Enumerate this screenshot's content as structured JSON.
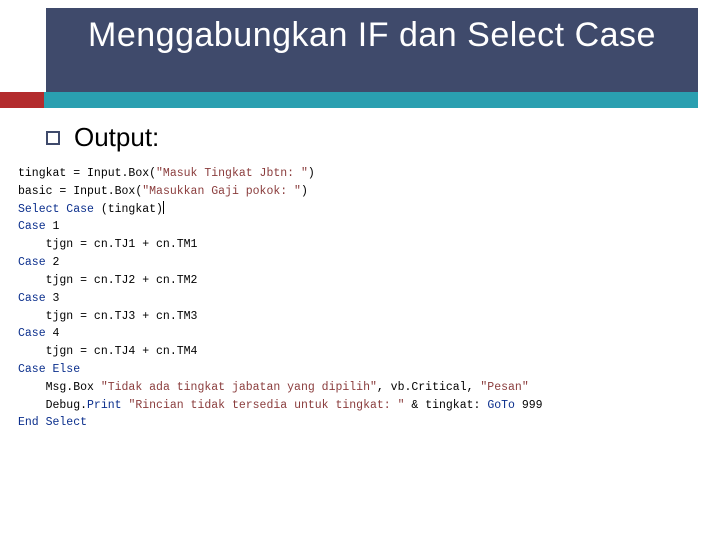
{
  "title": "Menggabungkan IF dan Select Case",
  "bullet_label": "Output:",
  "code": {
    "l1_a": "tingkat = Input.Box(",
    "l1_s": "\"Masuk Tingkat Jbtn: \"",
    "l1_b": ")",
    "l2_a": "basic = Input.Box(",
    "l2_s": "\"Masukkan Gaji pokok: \"",
    "l2_b": ")",
    "l3_k1": "Select Case",
    "l3_a": " (tingkat)",
    "l4_k": "Case",
    "l4_a": " 1",
    "l5_a": "    tjgn = cn.TJ1 + cn.TM1",
    "l6_k": "Case",
    "l6_a": " 2",
    "l7_a": "    tjgn = cn.TJ2 + cn.TM2",
    "l8_k": "Case",
    "l8_a": " 3",
    "l9_a": "    tjgn = cn.TJ3 + cn.TM3",
    "l10_k": "Case",
    "l10_a": " 4",
    "l11_a": "    tjgn = cn.TJ4 + cn.TM4",
    "l12_k": "Case Else",
    "l13_a": "    Msg.Box ",
    "l13_s1": "\"Tidak ada tingkat jabatan yang dipilih\"",
    "l13_b": ", vb.Critical, ",
    "l13_s2": "\"Pesan\"",
    "l14_a": "    Debug.",
    "l14_k": "Print",
    "l14_b": " ",
    "l14_s": "\"Rincian tidak tersedia untuk tingkat: \"",
    "l14_c": " & tingkat: ",
    "l14_k2": "GoTo",
    "l14_d": " 999",
    "l15_k": "End Select"
  }
}
